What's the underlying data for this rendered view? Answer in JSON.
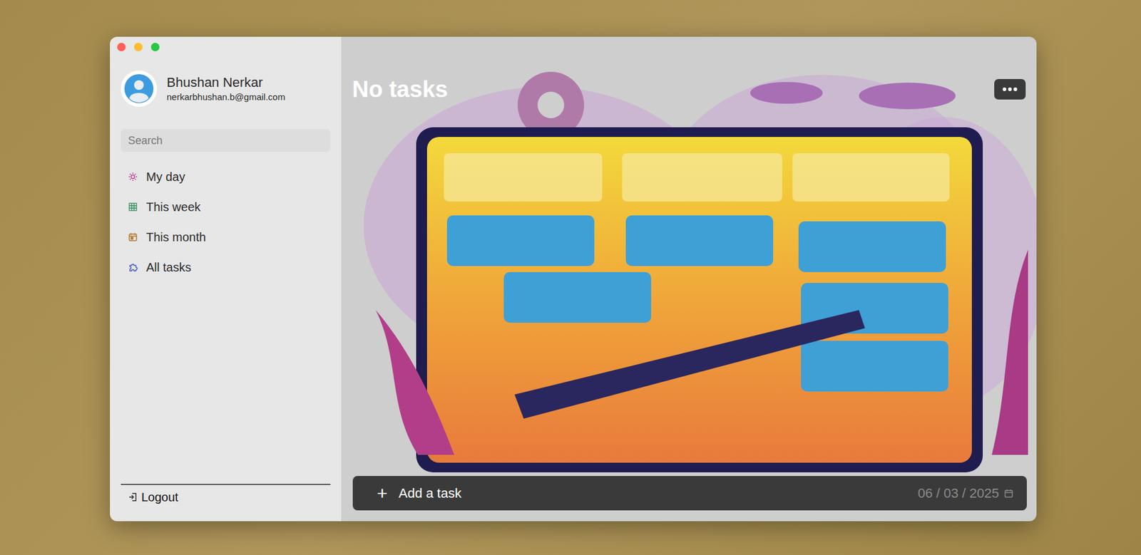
{
  "user": {
    "name": "Bhushan Nerkar",
    "email": "nerkarbhushan.b@gmail.com"
  },
  "search": {
    "placeholder": "Search"
  },
  "sidebar": {
    "items": [
      {
        "label": "My day",
        "selected": false,
        "color": "#c2368f"
      },
      {
        "label": "This week",
        "selected": false,
        "color": "#2e8b57"
      },
      {
        "label": "This month",
        "selected": false,
        "color": "#b0762c"
      },
      {
        "label": "All tasks",
        "selected": false,
        "color": "#3b4fc4"
      }
    ]
  },
  "logout": {
    "label": "Logout"
  },
  "main": {
    "heading": "No tasks"
  },
  "add_task": {
    "icon": "+",
    "label": "Add a task",
    "date": "06 / 03 / 2025"
  }
}
